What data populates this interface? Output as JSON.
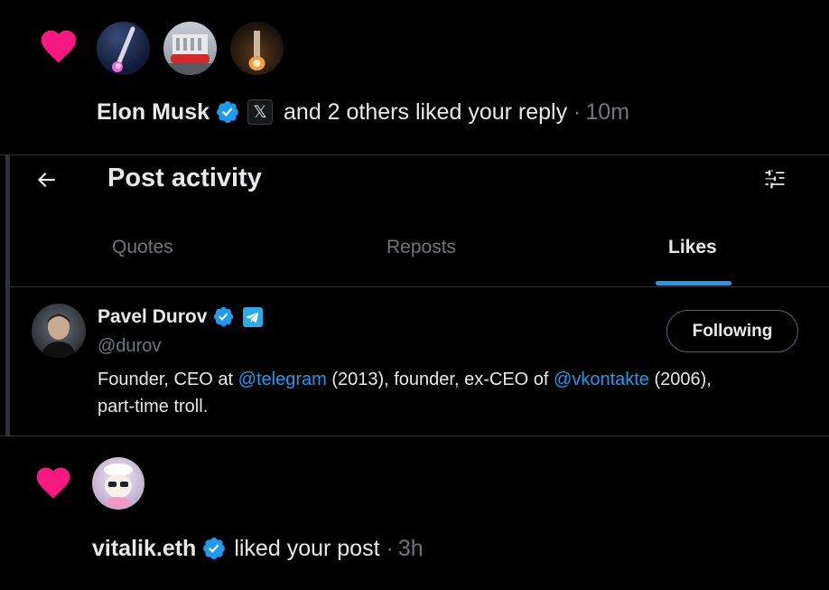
{
  "notification_1": {
    "liker_name": "Elon Musk",
    "affiliate_badge": "𝕏",
    "action_text": "and 2 others liked your reply",
    "separator": "·",
    "time": "10m",
    "heart_color": "#f91880"
  },
  "post_activity": {
    "title": "Post activity",
    "back_icon": "arrow-left-icon",
    "filter_icon": "sliders-icon",
    "tabs": [
      {
        "label": "Quotes",
        "active": false
      },
      {
        "label": "Reposts",
        "active": false
      },
      {
        "label": "Likes",
        "active": true
      }
    ],
    "tab_indicator_color": "#1d9bf0",
    "user": {
      "name": "Pavel Durov",
      "handle": "@durov",
      "follow_button": "Following",
      "bio_prefix": "Founder, CEO at ",
      "bio_link_1": "@telegram",
      "bio_middle": " (2013), founder, ex-CEO of ",
      "bio_link_2": "@vkontakte",
      "bio_suffix": " (2006),",
      "bio_line_2": "part-time troll."
    }
  },
  "notification_2": {
    "liker_name": "vitalik.eth",
    "action_text": "liked your post",
    "separator": "·",
    "time": "3h"
  }
}
